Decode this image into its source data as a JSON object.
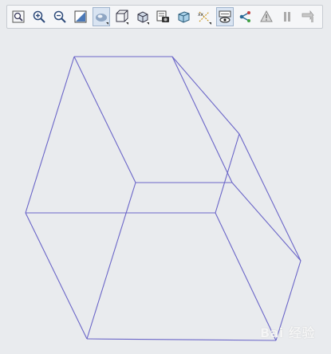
{
  "toolbar": {
    "buttons": [
      {
        "icon": "refit-icon"
      },
      {
        "icon": "zoom-in-icon"
      },
      {
        "icon": "zoom-out-icon"
      },
      {
        "icon": "repaint-icon"
      },
      {
        "icon": "shading-icon",
        "active": true
      },
      {
        "icon": "wireframe-display-icon"
      },
      {
        "icon": "saved-orientations-icon"
      },
      {
        "icon": "view-manager-icon"
      },
      {
        "icon": "perspective-view-icon"
      },
      {
        "icon": "datum-display-icon"
      },
      {
        "icon": "annotation-display-icon",
        "active": true
      },
      {
        "icon": "spin-center-icon"
      },
      {
        "icon": "warning-triangle-icon"
      },
      {
        "icon": "pause-icon"
      },
      {
        "icon": "next-icon"
      }
    ]
  },
  "model": {
    "edge_color": "#6b66c8"
  },
  "watermark": {
    "text": "Bai 经验"
  }
}
